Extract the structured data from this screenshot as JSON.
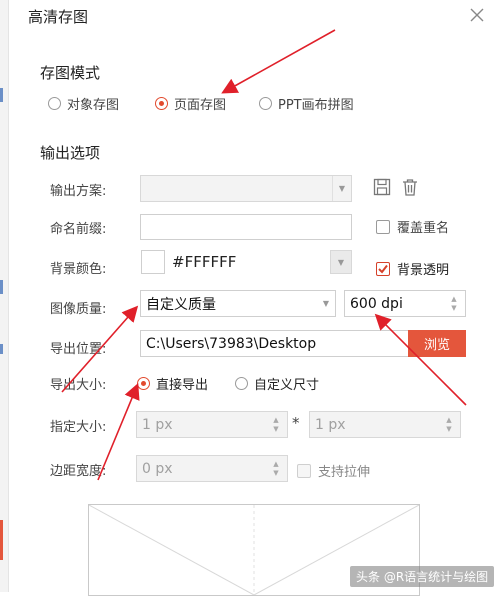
{
  "dialog": {
    "title": "高清存图"
  },
  "save_mode": {
    "heading": "存图模式",
    "options": [
      {
        "label": "对象存图",
        "selected": false
      },
      {
        "label": "页面存图",
        "selected": true
      },
      {
        "label": "PPT画布拼图",
        "selected": false
      }
    ]
  },
  "output": {
    "heading": "输出选项",
    "scheme_label": "输出方案:",
    "scheme_value": "",
    "prefix_label": "命名前缀:",
    "prefix_value": "",
    "overwrite_label": "覆盖重名",
    "overwrite_checked": false,
    "bg_label": "背景颜色:",
    "bg_color": "#FFFFFF",
    "bg_color_text": "#FFFFFF",
    "bg_transparent_label": "背景透明",
    "bg_transparent_checked": true,
    "quality_label": "图像质量:",
    "quality_value": "自定义质量",
    "dpi_value": "600 dpi",
    "path_label": "导出位置:",
    "path_value": "C:\\Users\\73983\\Desktop",
    "browse_label": "浏览",
    "size_label": "导出大小:",
    "size_options": [
      {
        "label": "直接导出",
        "selected": true
      },
      {
        "label": "自定义尺寸",
        "selected": false
      }
    ],
    "spec_size_label": "指定大小:",
    "width_value": "1 px",
    "times_symbol": "*",
    "height_value": "1 px",
    "margin_label": "边距宽度:",
    "margin_value": "0 px",
    "stretch_label": "支持拉伸",
    "stretch_checked": false
  },
  "colors": {
    "accent": "#e24a2e",
    "browse": "#e4563c",
    "arrow": "#e0202a"
  },
  "watermark": "头条 @R语言统计与绘图"
}
